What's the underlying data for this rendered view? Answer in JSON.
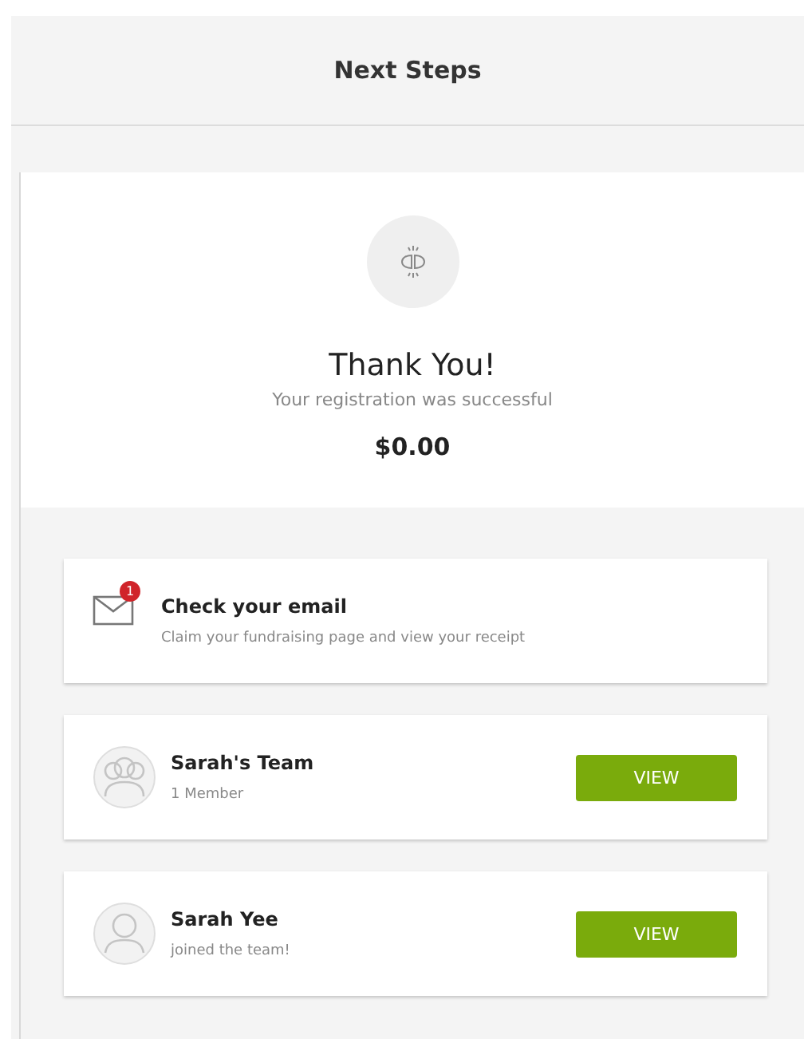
{
  "header": {
    "title": "Next Steps"
  },
  "confirmation": {
    "title": "Thank You!",
    "subtitle": "Your registration was successful",
    "amount": "$0.00"
  },
  "steps": [
    {
      "kind": "email",
      "title": "Check your email",
      "subtitle": "Claim your fundraising page and view your receipt",
      "badge": "1"
    },
    {
      "kind": "team",
      "title": "Sarah's Team",
      "subtitle": "1 Member",
      "button": "VIEW"
    },
    {
      "kind": "person",
      "title": "Sarah Yee",
      "subtitle": "joined the team!",
      "button": "VIEW"
    }
  ]
}
